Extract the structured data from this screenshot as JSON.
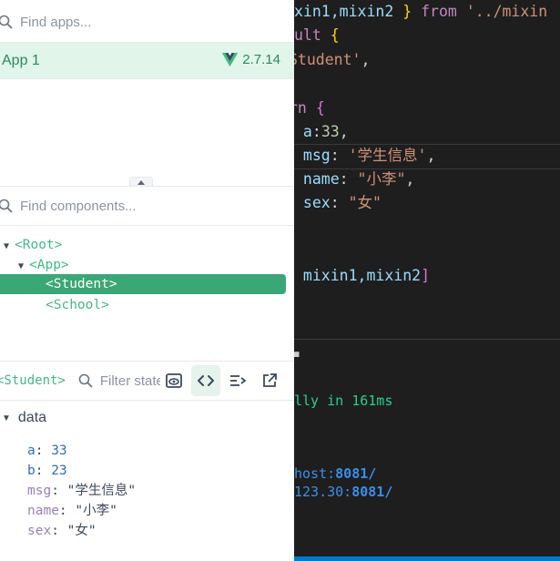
{
  "editor": {
    "lines": [
      {
        "parts": [
          {
            "t": "xin1,mixin2 ",
            "c": "prop"
          },
          {
            "t": "}",
            "c": "brace"
          },
          {
            "t": " from ",
            "c": "kw"
          },
          {
            "t": "'../mixin",
            "c": "str"
          }
        ]
      },
      {
        "parts": [
          {
            "t": "ult ",
            "c": "kw"
          },
          {
            "t": "{",
            "c": "brace"
          }
        ]
      },
      {
        "parts": [
          {
            "t": "Student'",
            "c": "str"
          },
          {
            "t": ",",
            "c": "plain"
          }
        ]
      },
      {
        "parts": [
          {
            "t": "rn ",
            "c": "kw"
          },
          {
            "t": "{",
            "c": "brace2"
          }
        ]
      },
      {
        "parts": [
          {
            "t": " a",
            "c": "prop"
          },
          {
            "t": ":",
            "c": "plain"
          },
          {
            "t": "33",
            "c": "num"
          },
          {
            "t": ",",
            "c": "plain"
          }
        ]
      },
      {
        "parts": [
          {
            "t": " msg",
            "c": "prop"
          },
          {
            "t": ": ",
            "c": "plain"
          },
          {
            "t": "'学生信息'",
            "c": "str"
          },
          {
            "t": ",",
            "c": "plain"
          }
        ]
      },
      {
        "parts": [
          {
            "t": " name",
            "c": "prop"
          },
          {
            "t": ": ",
            "c": "plain"
          },
          {
            "t": "\"小李\"",
            "c": "str"
          },
          {
            "t": ",",
            "c": "plain"
          }
        ]
      },
      {
        "parts": [
          {
            "t": " sex",
            "c": "prop"
          },
          {
            "t": ": ",
            "c": "plain"
          },
          {
            "t": "\"女\"",
            "c": "str"
          }
        ]
      },
      {
        "parts": [
          {
            "t": " mixin1,mixin2",
            "c": "prop"
          },
          {
            "t": "]",
            "c": "brace2"
          }
        ]
      }
    ]
  },
  "terminal": {
    "ready_text": "lly in 161ms",
    "local_host": "host:",
    "local_port": "8081/",
    "network_host": "123.30:",
    "network_port": "8081/"
  },
  "apps": {
    "search_placeholder": "Find apps...",
    "items": [
      {
        "name": "App 1",
        "vue_version": "2.7.14"
      }
    ]
  },
  "components": {
    "search_placeholder": "Find components...",
    "tree": [
      {
        "label": "<Root>",
        "depth": 0,
        "expanded": true
      },
      {
        "label": "<App>",
        "depth": 1,
        "expanded": true
      },
      {
        "label": "<Student>",
        "depth": 2,
        "selected": true
      },
      {
        "label": "<School>",
        "depth": 2
      }
    ]
  },
  "inspector": {
    "title": "<Student>",
    "filter_placeholder": "Filter state...",
    "section": "data",
    "data": [
      {
        "key": "a",
        "value": "33",
        "type": "number"
      },
      {
        "key": "b",
        "value": "23",
        "type": "number"
      },
      {
        "key": "msg",
        "value": "\"学生信息\"",
        "type": "string"
      },
      {
        "key": "name",
        "value": "\"小李\"",
        "type": "string"
      },
      {
        "key": "sex",
        "value": "\"女\"",
        "type": "string"
      }
    ]
  },
  "colors": {
    "accent": "#42b983",
    "selected": "#3ba776",
    "app_row_bg": "#e1f5ea"
  }
}
